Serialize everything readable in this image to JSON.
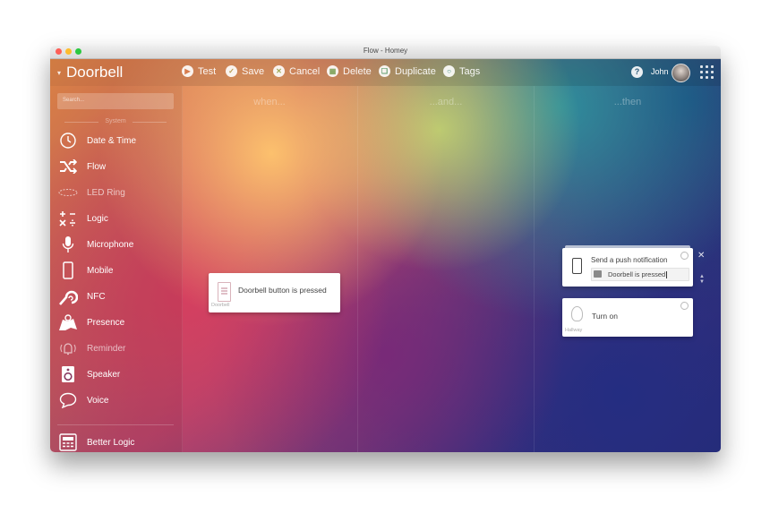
{
  "window": {
    "title": "Flow - Homey"
  },
  "header": {
    "flow_name": "Doorbell",
    "toolbar": [
      {
        "key": "test",
        "label": "Test",
        "icon": "play-icon"
      },
      {
        "key": "save",
        "label": "Save",
        "icon": "check-icon"
      },
      {
        "key": "cancel",
        "label": "Cancel",
        "icon": "x-icon"
      },
      {
        "key": "delete",
        "label": "Delete",
        "icon": "trash-icon"
      },
      {
        "key": "duplicate",
        "label": "Duplicate",
        "icon": "duplicate-icon"
      },
      {
        "key": "tags",
        "label": "Tags",
        "icon": "tag-icon"
      }
    ],
    "help_icon": "?",
    "user_name": "John"
  },
  "sidebar": {
    "search_placeholder": "Search...",
    "section_label": "System",
    "items": [
      {
        "label": "Date & Time",
        "icon": "clock-icon"
      },
      {
        "label": "Flow",
        "icon": "shuffle-icon"
      },
      {
        "label": "LED Ring",
        "icon": "led-ring-icon"
      },
      {
        "label": "Logic",
        "icon": "math-icon"
      },
      {
        "label": "Microphone",
        "icon": "microphone-icon"
      },
      {
        "label": "Mobile",
        "icon": "mobile-icon"
      },
      {
        "label": "NFC",
        "icon": "nfc-icon"
      },
      {
        "label": "Presence",
        "icon": "map-icon"
      },
      {
        "label": "Reminder",
        "icon": "bell-icon"
      },
      {
        "label": "Speaker",
        "icon": "speaker-icon"
      },
      {
        "label": "Voice",
        "icon": "speech-bubble-icon"
      },
      {
        "label": "Better Logic",
        "icon": "calculator-icon"
      }
    ]
  },
  "columns": {
    "when": "when...",
    "and": "...and...",
    "then": "...then"
  },
  "cards": {
    "when_card": {
      "text": "Doorbell button is pressed",
      "device": "Doorbell"
    },
    "notify_card": {
      "title": "Send a push notification",
      "value": "Doorbell is pressed"
    },
    "turnon_card": {
      "text": "Turn on",
      "device": "Hallway"
    }
  },
  "colors": {
    "accent": "#ffffff",
    "card_bg": "#ffffff"
  }
}
